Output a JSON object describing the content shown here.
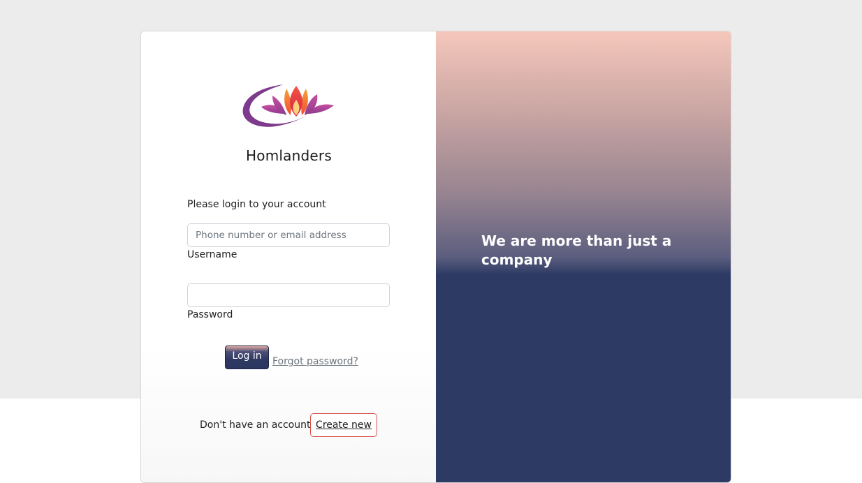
{
  "brand": {
    "name": "Homlanders",
    "logo_icon": "lotus-logo-icon"
  },
  "login_form": {
    "prompt": "Please login to your account",
    "username": {
      "placeholder": "Phone number or email address",
      "value": "",
      "label": "Username"
    },
    "password": {
      "placeholder": "",
      "value": "",
      "label": "Password"
    },
    "login_button_label": "Log in",
    "forgot_password_link": "Forgot password?"
  },
  "signup": {
    "prompt": "Don't have an account?",
    "create_button_label": "Create new"
  },
  "side_panel": {
    "tagline": "We are more than just a company"
  },
  "colors": {
    "page_background": "#ececec",
    "panel_dark": "#2d3a63",
    "panel_top": "#f5c7bb",
    "create_button_border": "#d9534f",
    "link_gray": "#6c757d"
  }
}
